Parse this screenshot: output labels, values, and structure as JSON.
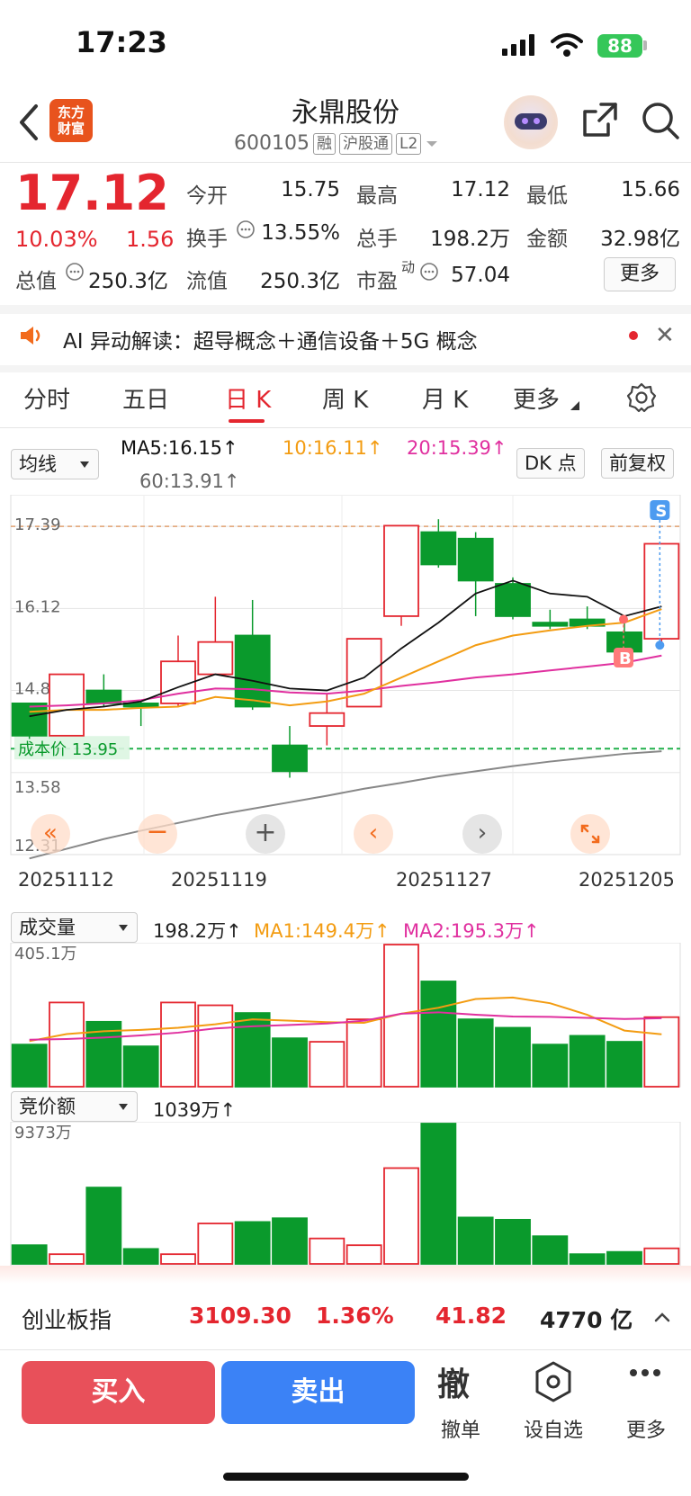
{
  "status_bar": {
    "time": "17:23",
    "battery": "88"
  },
  "header": {
    "logo_line1": "东方",
    "logo_line2": "财富",
    "stock_name": "永鼎股份",
    "stock_code": "600105",
    "tags": [
      "融",
      "沪股通",
      "L2"
    ]
  },
  "quote": {
    "price": "17.12",
    "pct_change": "10.03%",
    "change": "1.56",
    "fields": {
      "open_label": "今开",
      "open": "15.75",
      "high_label": "最高",
      "high": "17.12",
      "low_label": "最低",
      "low": "15.66",
      "turnover_label": "换手",
      "turnover": "13.55%",
      "volume_label": "总手",
      "volume": "198.2万",
      "amount_label": "金额",
      "amount": "32.98亿",
      "mktcap_label": "总值",
      "mktcap": "250.3亿",
      "float_label": "流值",
      "float": "250.3亿",
      "pe_label": "市盈",
      "pe_sup": "动",
      "pe": "57.04"
    },
    "more_label": "更多"
  },
  "ai_bar": {
    "text": "AI 异动解读：超导概念＋通信设备＋5G 概念"
  },
  "tabs": [
    "分时",
    "五日",
    "日 K",
    "周 K",
    "月 K",
    "更多"
  ],
  "kline": {
    "ma_select": "均线",
    "ma5": "MA5:16.15↑",
    "ma10": "10:16.11↑",
    "ma20": "20:15.39↑",
    "ma60": "60:13.91↑",
    "dk_label": "DK 点",
    "adjust_label": "前复权",
    "y_labels": [
      "17.39",
      "16.12",
      "14.85",
      "13.58",
      "12.31"
    ],
    "cost_label": "成本价 13.95",
    "x_labels": [
      "20251112",
      "20251119",
      "20251127",
      "20251205"
    ],
    "signal_s": "S",
    "signal_b": "B",
    "colors": {
      "up": "#e4262f",
      "down": "#0a9a2c",
      "ma5": "#111111",
      "ma10": "#f39c12",
      "ma20": "#e0309f",
      "ma60": "#888888"
    }
  },
  "volume": {
    "select": "成交量",
    "value": "198.2万↑",
    "ma1": "MA1:149.4万↑",
    "ma2": "MA2:195.3万↑",
    "max_label": "405.1万"
  },
  "auction": {
    "select": "竞价额",
    "value": "1039万↑",
    "max_label": "9373万"
  },
  "chart_data": {
    "type": "bar",
    "title": "",
    "candles": [
      {
        "o": 14.65,
        "c": 14.15,
        "h": 14.65,
        "l": 14.1
      },
      {
        "o": 14.15,
        "c": 15.1,
        "h": 15.1,
        "l": 14.15
      },
      {
        "o": 14.85,
        "c": 14.65,
        "h": 15.1,
        "l": 14.6
      },
      {
        "o": 14.65,
        "c": 14.6,
        "h": 14.7,
        "l": 14.3
      },
      {
        "o": 14.65,
        "c": 15.3,
        "h": 15.7,
        "l": 14.6
      },
      {
        "o": 15.1,
        "c": 15.6,
        "h": 16.3,
        "l": 15.1
      },
      {
        "o": 15.7,
        "c": 14.6,
        "h": 16.25,
        "l": 14.55
      },
      {
        "o": 14.0,
        "c": 13.6,
        "h": 14.3,
        "l": 13.5
      },
      {
        "o": 14.3,
        "c": 14.5,
        "h": 14.8,
        "l": 14.0
      },
      {
        "o": 14.6,
        "c": 15.65,
        "h": 15.65,
        "l": 14.6
      },
      {
        "o": 16.0,
        "c": 17.4,
        "h": 17.4,
        "l": 15.85
      },
      {
        "o": 17.3,
        "c": 16.8,
        "h": 17.5,
        "l": 16.75
      },
      {
        "o": 17.2,
        "c": 16.55,
        "h": 17.3,
        "l": 16.0
      },
      {
        "o": 16.5,
        "c": 16.0,
        "h": 16.6,
        "l": 15.95
      },
      {
        "o": 15.9,
        "c": 15.85,
        "h": 16.1,
        "l": 15.8
      },
      {
        "o": 15.95,
        "c": 15.85,
        "h": 16.15,
        "l": 15.8
      },
      {
        "o": 15.75,
        "c": 15.45,
        "h": 15.9,
        "l": 15.4
      },
      {
        "o": 15.65,
        "c": 17.12,
        "h": 17.12,
        "l": 15.6
      }
    ],
    "ma5": [
      14.45,
      14.55,
      14.6,
      14.68,
      14.9,
      15.1,
      15.0,
      14.88,
      14.85,
      15.05,
      15.5,
      15.9,
      16.35,
      16.55,
      16.35,
      16.3,
      16.0,
      16.15
    ],
    "ma10": [
      14.52,
      14.55,
      14.55,
      14.58,
      14.6,
      14.75,
      14.7,
      14.62,
      14.68,
      14.8,
      15.05,
      15.3,
      15.55,
      15.7,
      15.78,
      15.85,
      15.9,
      16.11
    ],
    "ma20": [
      14.6,
      14.62,
      14.65,
      14.7,
      14.8,
      14.88,
      14.87,
      14.82,
      14.8,
      14.85,
      14.92,
      14.98,
      15.05,
      15.1,
      15.16,
      15.22,
      15.28,
      15.39
    ],
    "ma60": [
      12.25,
      12.4,
      12.55,
      12.68,
      12.8,
      12.92,
      13.02,
      13.12,
      13.22,
      13.33,
      13.42,
      13.52,
      13.6,
      13.68,
      13.75,
      13.81,
      13.87,
      13.91
    ],
    "ylim": [
      12.31,
      17.6
    ],
    "reference_lines": {
      "high_dashed": 17.39,
      "cost": 13.95
    },
    "volumes": [
      120,
      240,
      185,
      115,
      240,
      232,
      210,
      138,
      128,
      192,
      405,
      300,
      192,
      168,
      120,
      145,
      128,
      198.2
    ],
    "vol_ma1": [
      130,
      150,
      158,
      162,
      168,
      178,
      192,
      188,
      184,
      182,
      208,
      225,
      250,
      254,
      238,
      205,
      160,
      149.4
    ],
    "vol_ma2": [
      134,
      136,
      140,
      146,
      154,
      166,
      172,
      176,
      180,
      188,
      208,
      212,
      205,
      200,
      199,
      196,
      193,
      195.3
    ],
    "vol_max": 405.1,
    "auction": [
      1250,
      650,
      5100,
      1000,
      650,
      2700,
      2800,
      3050,
      1700,
      1250,
      6400,
      9373,
      3100,
      2950,
      1850,
      650,
      800,
      1039
    ],
    "auction_max": 9373
  }
}
